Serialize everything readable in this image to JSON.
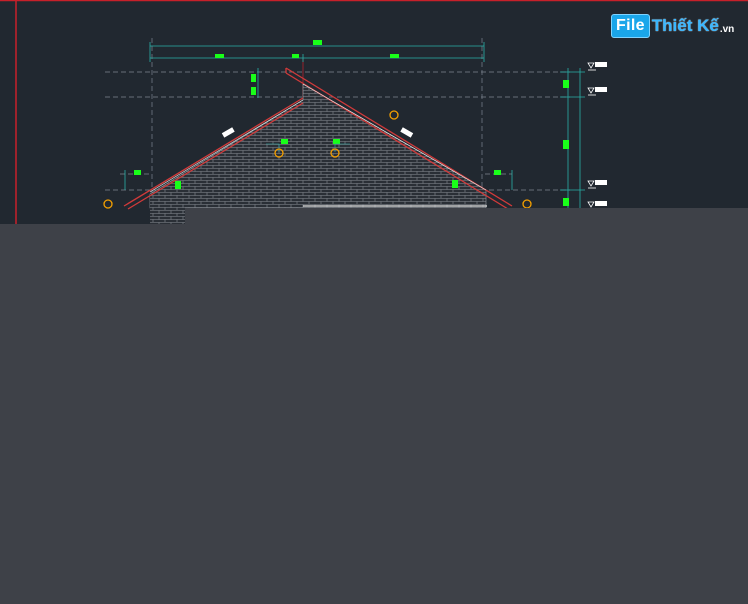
{
  "watermark": {
    "box_text": "File",
    "text": "Thiết Kế",
    "ext": ".vn"
  },
  "colors": {
    "background": "#212830",
    "frame_red": "#c8202a",
    "roof_red": "#d23a3a",
    "dim_teal": "#2ab0a8",
    "dim_green": "#19ff19",
    "marker_orange": "#f5a000",
    "overlay": "#3e4148"
  },
  "icons": [
    "level-marker-icon",
    "grid-bubble-icon",
    "dimension-tick-icon"
  ]
}
